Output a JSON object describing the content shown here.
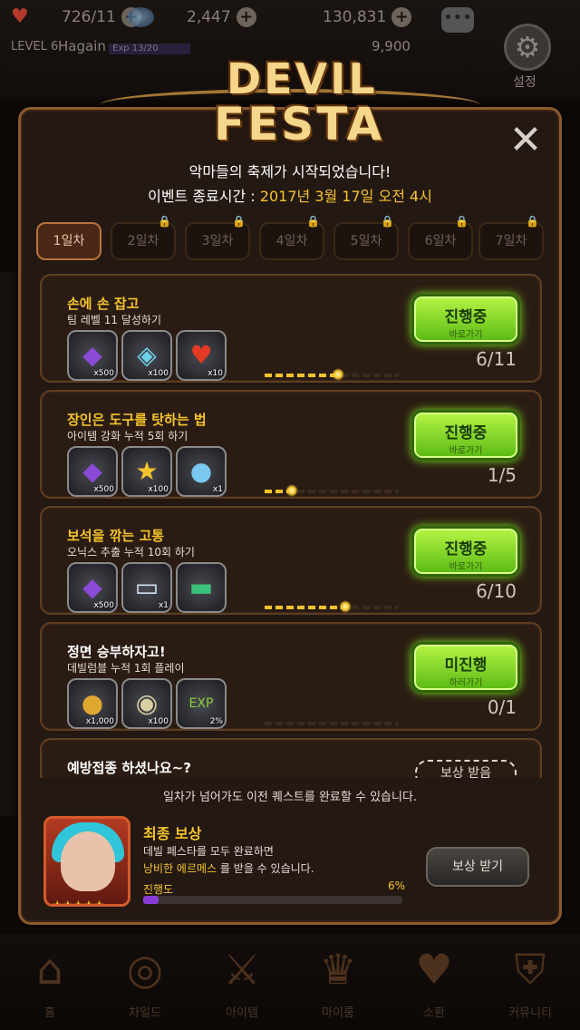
{
  "hud": {
    "stamina": "726/11",
    "gems": "2,447",
    "gold": "130,831",
    "level": "LEVEL 6",
    "name": "Hagain",
    "exp": "Exp 13/20",
    "sub_gold": "9,900",
    "settings_label": "설정"
  },
  "logo": {
    "line1": "DEVIL",
    "line2": "FESTA"
  },
  "event": {
    "start_text": "악마들의 축제가 시작되었습니다!",
    "end_label": "이벤트 종료시간 :",
    "end_value": "2017년 3월 17일 오전 4시"
  },
  "tabs": [
    {
      "label": "1일차",
      "locked": false
    },
    {
      "label": "2일차",
      "locked": true
    },
    {
      "label": "3일차",
      "locked": true
    },
    {
      "label": "4일차",
      "locked": true
    },
    {
      "label": "5일차",
      "locked": true
    },
    {
      "label": "6일차",
      "locked": true
    },
    {
      "label": "7일차",
      "locked": true
    }
  ],
  "quests": [
    {
      "title": "손에 손 잡고",
      "desc": "팀 레벨 11 달성하기",
      "rewards": [
        {
          "icon": "purple-gem-icon",
          "qty": "x500"
        },
        {
          "icon": "rainbow-crystal-icon",
          "qty": "x100"
        },
        {
          "icon": "heart-icon",
          "qty": "x10"
        }
      ],
      "button_main": "진행중",
      "button_sub": "바로가기",
      "count": "6/11",
      "progress": 0.545
    },
    {
      "title": "장인은 도구를 탓하는 법",
      "desc": "아이템 강화 누적 5회 하기",
      "rewards": [
        {
          "icon": "purple-gem-icon",
          "qty": "x500"
        },
        {
          "icon": "star-medal-icon",
          "qty": "x100"
        },
        {
          "icon": "blue-slime-icon",
          "qty": "x1"
        }
      ],
      "button_main": "진행중",
      "button_sub": "바로가기",
      "count": "1/5",
      "progress": 0.2
    },
    {
      "title": "보석을 깎는 고통",
      "desc": "오닉스 추출 누적 10회 하기",
      "rewards": [
        {
          "icon": "purple-gem-icon",
          "qty": "x500"
        },
        {
          "icon": "ticket-icon",
          "qty": "x1"
        },
        {
          "icon": "green-card-icon",
          "qty": ""
        }
      ],
      "button_main": "진행중",
      "button_sub": "바로가기",
      "count": "6/10",
      "progress": 0.6
    },
    {
      "title": "정면 승부하자고!",
      "desc": "데빌럼블 누적 1회 플레이",
      "rewards": [
        {
          "icon": "gold-coins-icon",
          "qty": "x1,000"
        },
        {
          "icon": "silver-coin-icon",
          "qty": "x100"
        },
        {
          "icon": "user-exp-icon",
          "qty": "2%"
        }
      ],
      "button_main": "미진행",
      "button_sub": "하러가기",
      "count": "0/1",
      "progress": 0
    },
    {
      "title": "예방접종 하셨나요~?",
      "desc": "",
      "rewards": [],
      "button_main": "보상 받음",
      "button_sub": "",
      "count": "",
      "progress": 0
    }
  ],
  "notice": "일차가 넘어가도 이전 퀘스트를 완료할 수 있습니다.",
  "final": {
    "title": "최종 보상",
    "desc1": "데빌 페스타를 모두 완료하면",
    "desc2_hl": "낭비한 에르메스",
    "desc2_rest": " 를 받을 수 있습니다.",
    "progress_label": "진행도",
    "progress_pct": "6%",
    "progress": 0.06,
    "button": "보상 받기",
    "stars": "★★★★★"
  },
  "nav": [
    {
      "label": "홈",
      "icon": "home-icon"
    },
    {
      "label": "차일드",
      "icon": "child-icon"
    },
    {
      "label": "아이템",
      "icon": "item-icon"
    },
    {
      "label": "마이룸",
      "icon": "myroom-icon"
    },
    {
      "label": "소환",
      "icon": "summon-icon"
    },
    {
      "label": "커뮤니티",
      "icon": "community-icon"
    }
  ],
  "colors": {
    "accent": "#f6c42a",
    "button_green": "#7fe022",
    "panel": "#231812",
    "border": "#8a5a2e"
  }
}
